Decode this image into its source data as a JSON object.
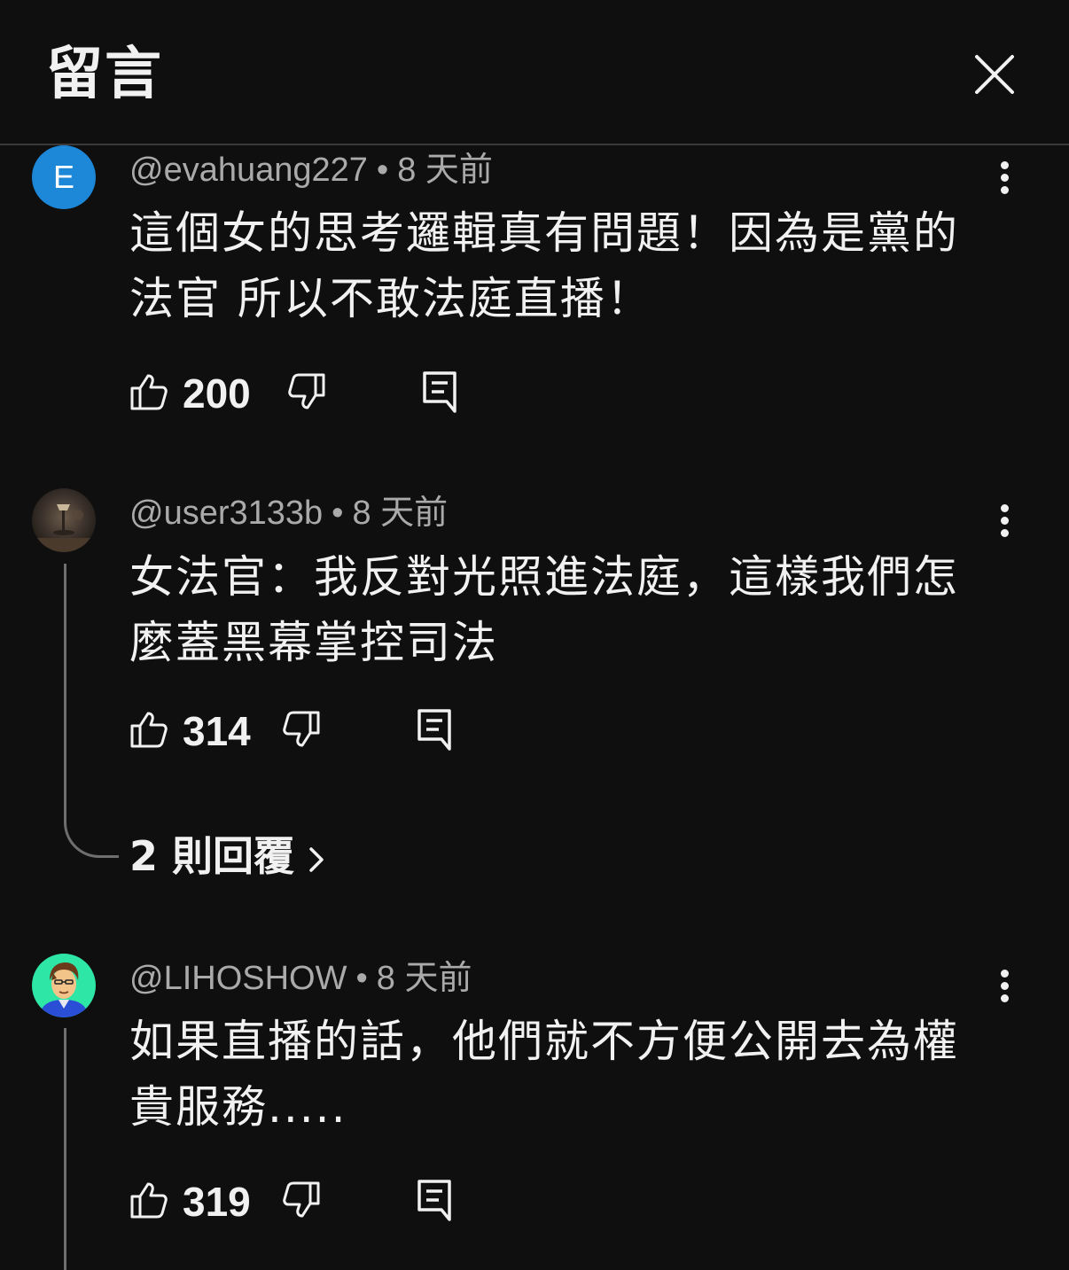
{
  "header": {
    "title": "留言"
  },
  "comments": [
    {
      "avatar_letter": "E",
      "avatar_color": "#1e88d8",
      "author": "@evahuang227",
      "separator": "•",
      "time": "8 天前",
      "text": "這個女的思考邏輯真有問題！因為是黨的法官 所以不敢法庭直播！",
      "likes": "200"
    },
    {
      "avatar_icon": "lamp-photo-avatar",
      "author": "@user3133b",
      "separator": "•",
      "time": "8 天前",
      "text": "女法官：我反對光照進法庭，這樣我們怎麼蓋黑幕掌控司法",
      "likes": "314",
      "replies_label": "2 則回覆"
    },
    {
      "avatar_icon": "cartoon-face-avatar",
      "author": "@LIHOSHOW",
      "separator": "•",
      "time": "8 天前",
      "text": "如果直播的話，他們就不方便公開去為權貴服務.....",
      "likes": "319"
    }
  ],
  "colors": {
    "background": "#0f0f0f",
    "text_primary": "#f1f1f1",
    "text_secondary": "#aaaaaa",
    "thread_line": "#6e6e6e"
  }
}
